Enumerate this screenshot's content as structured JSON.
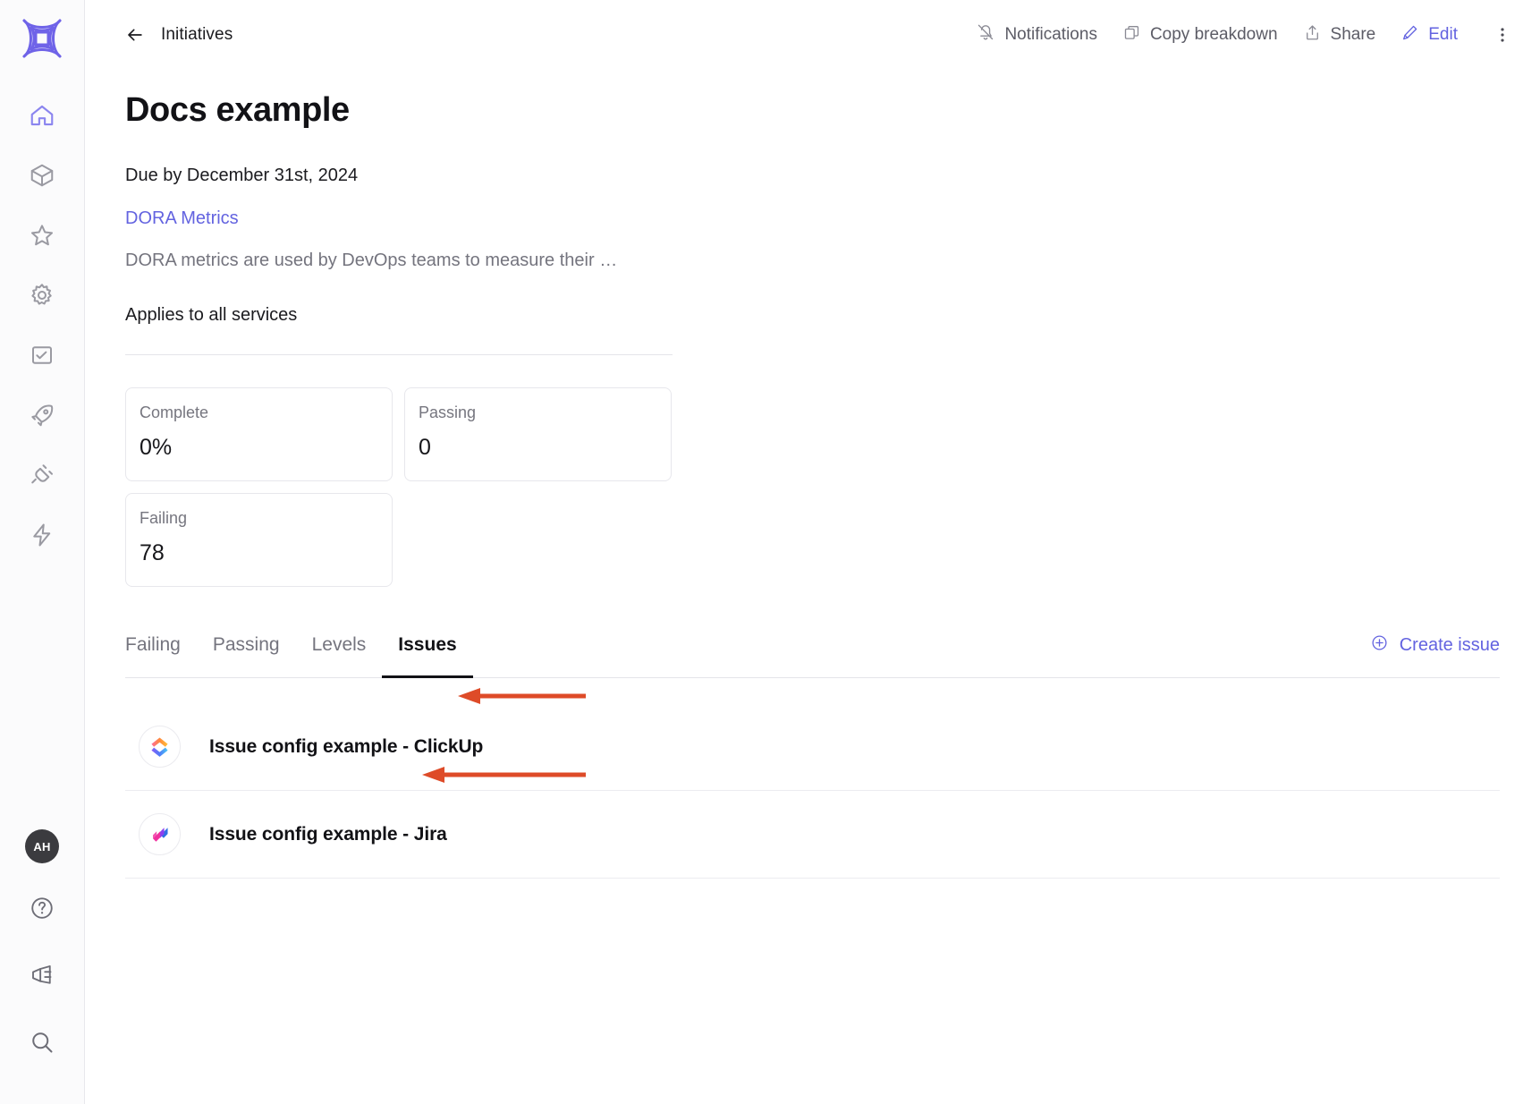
{
  "sidebar": {
    "logo": {
      "name": "cortex-logo",
      "color": "#6f63e8"
    },
    "top_items": [
      {
        "id": "home",
        "icon": "home-icon",
        "active": true
      },
      {
        "id": "catalog",
        "icon": "cube-icon",
        "active": false
      },
      {
        "id": "scorecards",
        "icon": "star-icon",
        "active": false
      },
      {
        "id": "settings",
        "icon": "gear-icon",
        "active": false
      },
      {
        "id": "reports",
        "icon": "checked-window-icon",
        "active": false
      },
      {
        "id": "launch",
        "icon": "rocket-icon",
        "active": false
      },
      {
        "id": "integrations",
        "icon": "plug-icon",
        "active": false
      },
      {
        "id": "actions",
        "icon": "lightning-icon",
        "active": false
      }
    ],
    "bottom_items": [
      {
        "id": "profile",
        "icon": "avatar",
        "initials": "AH"
      },
      {
        "id": "help",
        "icon": "question-circle-icon"
      },
      {
        "id": "announce",
        "icon": "megaphone-icon"
      },
      {
        "id": "search",
        "icon": "search-icon"
      }
    ]
  },
  "topbar": {
    "back_icon": "arrow-left-icon",
    "breadcrumb": "Initiatives",
    "actions": [
      {
        "id": "notifications",
        "label": "Notifications",
        "icon": "bell-off-icon",
        "accent": false
      },
      {
        "id": "copy-breakdown",
        "label": "Copy breakdown",
        "icon": "copy-icon",
        "accent": false
      },
      {
        "id": "share",
        "label": "Share",
        "icon": "share-icon",
        "accent": false
      },
      {
        "id": "edit",
        "label": "Edit",
        "icon": "pencil-icon",
        "accent": true
      }
    ],
    "kebab_icon": "more-vertical-icon"
  },
  "page": {
    "title": "Docs example",
    "due": "Due by December 31st, 2024",
    "metric_link": "DORA Metrics",
    "metric_description": "DORA metrics are used by DevOps teams to measure their …",
    "applies_to": "Applies to all services"
  },
  "stats": [
    {
      "label": "Complete",
      "value": "0%"
    },
    {
      "label": "Passing",
      "value": "0"
    },
    {
      "label": "Failing",
      "value": "78"
    }
  ],
  "tabs": [
    {
      "id": "failing",
      "label": "Failing",
      "active": false
    },
    {
      "id": "passing",
      "label": "Passing",
      "active": false
    },
    {
      "id": "levels",
      "label": "Levels",
      "active": false
    },
    {
      "id": "issues",
      "label": "Issues",
      "active": true
    }
  ],
  "create_issue": {
    "label": "Create issue",
    "icon": "plus-circle-icon"
  },
  "issues": [
    {
      "id": "clickup",
      "title": "Issue config example - ClickUp",
      "icon": "clickup-logo-icon",
      "annotated": true
    },
    {
      "id": "jira",
      "title": "Issue config example - Jira",
      "icon": "jira-logo-icon",
      "annotated": true
    }
  ],
  "annotations": {
    "arrow_color": "#de4b28",
    "arrows": [
      {
        "target": "clickup-issue-row",
        "direction": "left"
      },
      {
        "target": "jira-issue-row",
        "direction": "left"
      }
    ]
  },
  "colors": {
    "accent_purple": "#6363e0",
    "text_primary": "#121216",
    "text_muted": "#74747e",
    "border": "#e7e7ec",
    "rail_bg": "#fbfbfc",
    "annotation_red": "#de4b28"
  }
}
